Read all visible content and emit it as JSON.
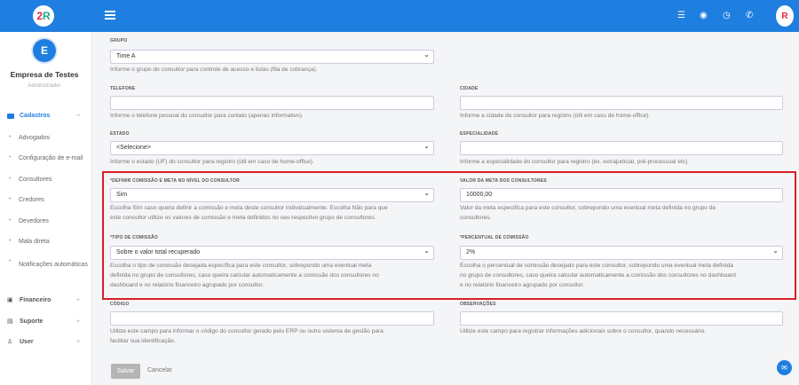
{
  "company": {
    "initial": "E",
    "name": "Empresa de Testes",
    "role": "Administrador"
  },
  "nav": [
    {
      "label": "Cadastros",
      "icon": "folder-icon",
      "active": true,
      "toggle": "−"
    },
    {
      "label": "Financeiro",
      "icon": "money-icon",
      "toggle": "+"
    },
    {
      "label": "Suporte",
      "icon": "chat-icon",
      "toggle": "+"
    },
    {
      "label": "User",
      "icon": "user-icon",
      "toggle": "+"
    }
  ],
  "subnav": [
    "Advogados",
    "Configuração de e-mail",
    "Consultores",
    "Credores",
    "Devedores",
    "Mala direta",
    "Notificações automáticas"
  ],
  "topbar": {
    "icons": [
      "list-icon",
      "mask-icon",
      "clock-icon",
      "whatsapp-icon"
    ],
    "accent": "#1f7fe0"
  },
  "form": {
    "grupo": {
      "label": "GRUPO",
      "value": "Time A",
      "help": "Informe o grupo do consultor para controle de acesso e listas (fila de cobrança)."
    },
    "telefone": {
      "label": "TELEFONE",
      "value": "",
      "help": "Informe o telefone pessoal do consultor para contato (apenas informativo)."
    },
    "cidade": {
      "label": "CIDADE",
      "value": "",
      "help": "Informe a cidade do consultor para registro (útil em caso de home-office)."
    },
    "estado": {
      "label": "ESTADO",
      "value": "<Selecione>",
      "help": "Informe o estado (UF) do consultor para registro (útil em caso de home-office)."
    },
    "especialidade": {
      "label": "ESPECIALIDADE",
      "value": "",
      "help": "Informe a especialidade do consultor para registro (ex. extrajudicial, pré-processual etc)."
    },
    "definir": {
      "label": "*DEFINIR COMISSÃO E META NO NÍVEL DO CONSULTOR",
      "value": "Sim",
      "help1": "Escolha Sim caso queira definir a comissão e meta deste consultor individualmente. Escolha Não para que",
      "help2": "este consultor utilize os valores de comissão e meta definidos no seu respectivo grupo de consultores."
    },
    "meta": {
      "label": "VALOR DA META DOS CONSULTORES",
      "value": "10000,00",
      "help1": "Valor da meta específica para este consultor, sobrepondo uma eventual meta definida no grupo de",
      "help2": "consultores."
    },
    "tipo": {
      "label": "*TIPO DE COMISSÃO",
      "value": "Sobre o valor total recuperado",
      "help1": "Escolha o tipo de comissão desejada específica para este consultor, sobrepondo uma eventual meta",
      "help2": "definida no grupo de consultores, caso queira calcular automaticamente a comissão dos consultores no",
      "help3": "dashboard e no relatório financeiro agrupado por consultor."
    },
    "percentual": {
      "label": "*PERCENTUAL DE COMISSÃO",
      "value": "2%",
      "help1": "Escolha o percentual de comissão desejado para este consultor, sobrepondo uma eventual meta definida",
      "help2": "no grupo de consultores, caso queira calcular automaticamente a comissão dos consultores no dashboard",
      "help3": "e no relatório financeiro agrupado por consultor."
    },
    "codigo": {
      "label": "CÓDIGO",
      "value": "",
      "help1": "Utilize este campo para informar o código do consultor gerado pelo ERP ou outro sistema de gestão para",
      "help2": "facilitar sua identificação."
    },
    "observacoes": {
      "label": "OBSERVAÇÕES",
      "value": "",
      "help": "Utilize este campo para registrar informações adicionais sobre o consultor, quando necessário."
    }
  },
  "actions": {
    "save": "Salvar",
    "cancel": "Cancelar"
  }
}
